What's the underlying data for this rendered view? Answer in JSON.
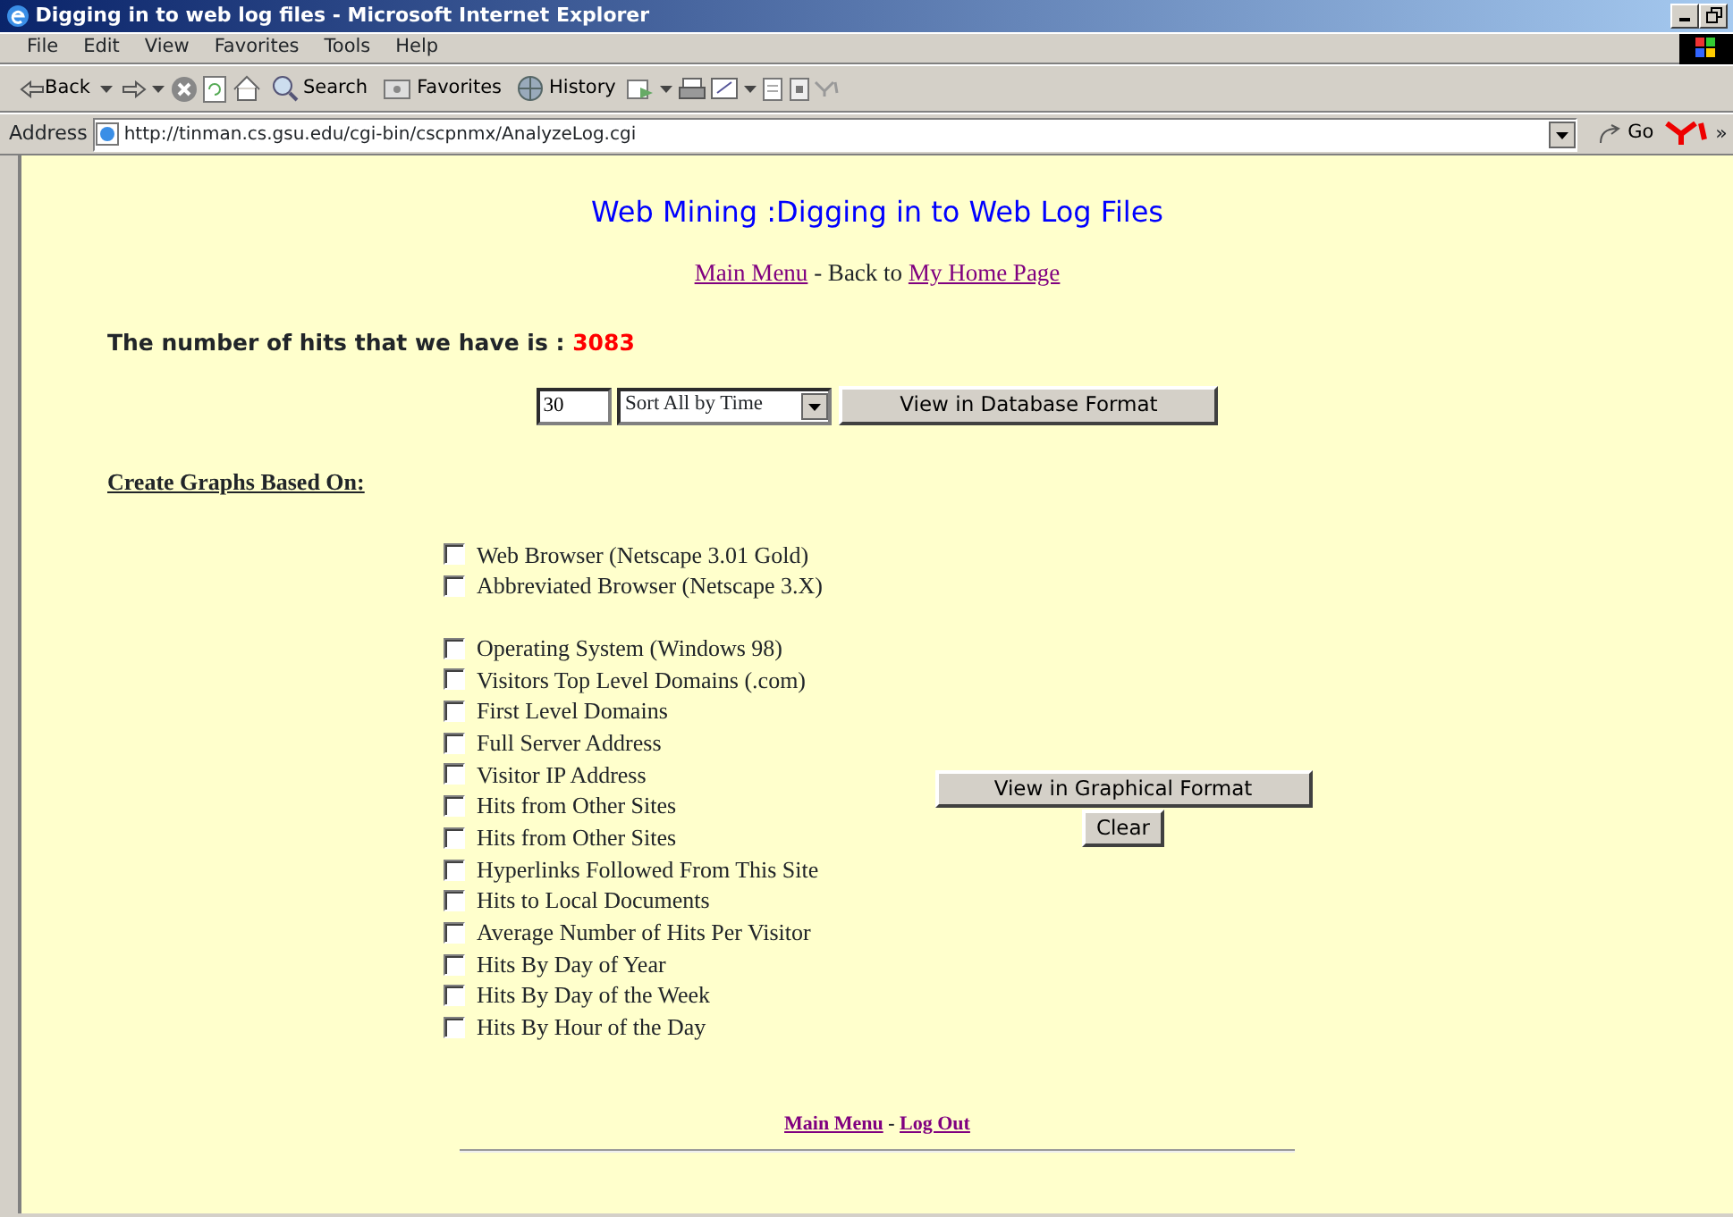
{
  "window": {
    "title": "Digging in to web log files - Microsoft Internet Explorer"
  },
  "menu": [
    "File",
    "Edit",
    "View",
    "Favorites",
    "Tools",
    "Help"
  ],
  "toolbar": {
    "back": "Back",
    "search": "Search",
    "favorites": "Favorites",
    "history": "History"
  },
  "address_bar": {
    "label": "Address",
    "url": "http://tinman.cs.gsu.edu/cgi-bin/cscpnmx/AnalyzeLog.cgi",
    "go": "Go",
    "more": "»"
  },
  "page": {
    "heading": "Web Mining :Digging in to Web Log Files",
    "nav": [
      {
        "kind": "link",
        "text": "Main Menu"
      },
      {
        "kind": "text",
        "text": " - Back to "
      },
      {
        "kind": "link",
        "text": "My Home Page"
      }
    ],
    "hits": {
      "label": "The number of hits that we have is :",
      "count": "3083"
    },
    "query": {
      "count_value": "30",
      "sort_value": "Sort All by Time",
      "button": "View in Database Format"
    },
    "graphs_heading": "Create Graphs Based On:",
    "option_groups": [
      [
        {
          "label": "Web Browser (Netscape 3.01 Gold)",
          "checked": false
        },
        {
          "label": "Abbreviated Browser (Netscape 3.X)",
          "checked": false
        }
      ],
      [
        {
          "label": "Operating System (Windows 98)",
          "checked": false
        },
        {
          "label": "Visitors Top Level Domains (.com)",
          "checked": false
        },
        {
          "label": "First Level Domains",
          "checked": false
        },
        {
          "label": "Full Server Address",
          "checked": false
        },
        {
          "label": "Visitor IP Address",
          "checked": false
        },
        {
          "label": "Hits from Other Sites",
          "checked": false
        },
        {
          "label": "Hits from Other Sites",
          "checked": false
        },
        {
          "label": "Hyperlinks Followed From This Site",
          "checked": false
        },
        {
          "label": "Hits to Local Documents",
          "checked": false
        },
        {
          "label": "Average Number of Hits Per Visitor",
          "checked": false
        },
        {
          "label": "Hits By Day of Year",
          "checked": false
        },
        {
          "label": "Hits By Day of the Week",
          "checked": false
        },
        {
          "label": "Hits By Hour of the Day",
          "checked": false
        }
      ]
    ],
    "graph_button": "View in Graphical Format",
    "clear_button": "Clear",
    "footer": [
      {
        "kind": "link",
        "text": "Main Menu"
      },
      {
        "kind": "text",
        "text": " - "
      },
      {
        "kind": "link",
        "text": "Log Out"
      }
    ]
  }
}
